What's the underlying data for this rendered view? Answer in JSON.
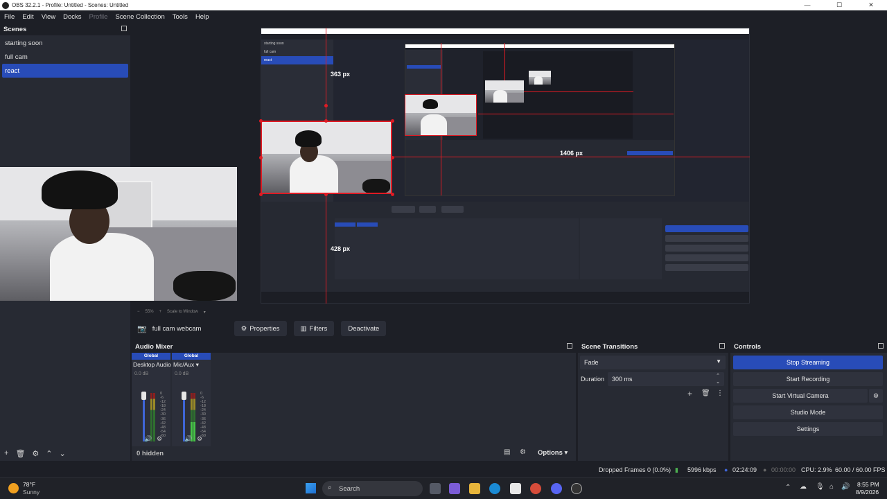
{
  "window": {
    "title": "OBS 32.2.1 - Profile: Untitled - Scenes: Untitled"
  },
  "menu": [
    "File",
    "Edit",
    "View",
    "Docks",
    "Profile",
    "Scene Collection",
    "Tools",
    "Help"
  ],
  "scenes": {
    "header": "Scenes",
    "items": [
      "starting soon",
      "full cam",
      "react"
    ],
    "selected": "react"
  },
  "preview": {
    "zoom": "55%",
    "zoom_mode": "Scale to Window",
    "labels": {
      "top": "363 px",
      "right": "1406 px",
      "bottom": "428 px"
    },
    "nested_scenes": [
      "starting soon",
      "full cam",
      "react"
    ]
  },
  "source_toolbar": {
    "source_name": "full cam webcam",
    "properties": "Properties",
    "filters": "Filters",
    "deactivate": "Deactivate"
  },
  "audio_mixer": {
    "header": "Audio Mixer",
    "channels": [
      {
        "scope": "Global",
        "name": "Desktop Audio",
        "db": "0.0 dB"
      },
      {
        "scope": "Global",
        "name": "Mic/Aux",
        "db": "0.0 dB"
      }
    ],
    "ticks": [
      "0",
      "-6",
      "-12",
      "-18",
      "-24",
      "-30",
      "-36",
      "-42",
      "-48",
      "-54",
      "-60"
    ],
    "hidden": "0 hidden",
    "options": "Options"
  },
  "scene_transitions": {
    "header": "Scene Transitions",
    "transition": "Fade",
    "duration_label": "Duration",
    "duration": "300 ms"
  },
  "controls": {
    "header": "Controls",
    "stop_streaming": "Stop Streaming",
    "start_recording": "Start Recording",
    "start_virtual_camera": "Start Virtual Camera",
    "studio_mode": "Studio Mode",
    "settings": "Settings",
    "accent": "#284cb8"
  },
  "status": {
    "dropped_frames": "Dropped Frames 0 (0.0%)",
    "bitrate": "5996 kbps",
    "stream_time": "02:24:09",
    "record_time": "00:00:00",
    "cpu": "CPU: 2.9%",
    "fps": "60.00 / 60.00 FPS"
  },
  "taskbar": {
    "weather_temp": "78°F",
    "weather_cond": "Sunny",
    "search": "Search",
    "time": "8:55 PM",
    "date": "8/9/2026"
  }
}
